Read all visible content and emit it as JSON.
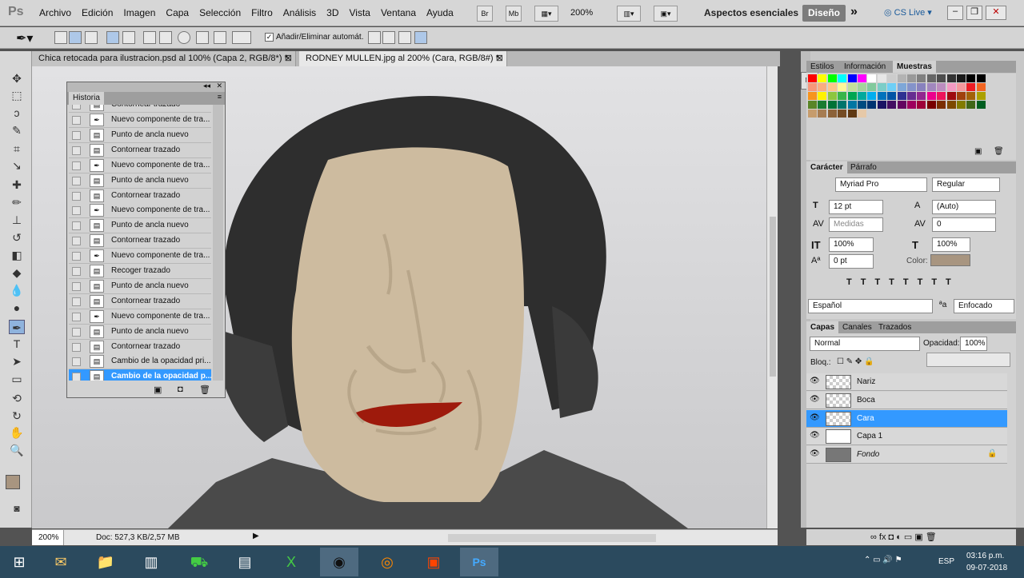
{
  "app": {
    "logo": "Ps"
  },
  "menus": [
    "Archivo",
    "Edición",
    "Imagen",
    "Capa",
    "Selección",
    "Filtro",
    "Análisis",
    "3D",
    "Vista",
    "Ventana",
    "Ayuda"
  ],
  "topbar": {
    "br": "Br",
    "mb": "Mb",
    "zoom": "200%",
    "workspace": "Aspectos esenciales",
    "design": "Diseño",
    "cslive": "CS Live"
  },
  "options": {
    "add_remove": "Añadir/Eliminar automát."
  },
  "tabs": [
    {
      "label": "Chica retocada para ilustracion.psd al 100% (Capa 2, RGB/8*) *"
    },
    {
      "label": "RODNEY MULLEN.jpg al 200% (Cara, RGB/8#) *"
    }
  ],
  "history": {
    "title": "Historia",
    "items": [
      {
        "icon": "pen-icon",
        "label": "Nuevo componente de tra..."
      },
      {
        "icon": "doc-icon",
        "label": "Punto de ancla nuevo"
      },
      {
        "icon": "doc-icon",
        "label": "Contornear trazado"
      },
      {
        "icon": "pen-icon",
        "label": "Nuevo componente de tra..."
      },
      {
        "icon": "doc-icon",
        "label": "Punto de ancla nuevo"
      },
      {
        "icon": "doc-icon",
        "label": "Contornear trazado"
      },
      {
        "icon": "pen-icon",
        "label": "Nuevo componente de tra..."
      },
      {
        "icon": "doc-icon",
        "label": "Punto de ancla nuevo"
      },
      {
        "icon": "doc-icon",
        "label": "Contornear trazado"
      },
      {
        "icon": "pen-icon",
        "label": "Nuevo componente de tra..."
      },
      {
        "icon": "doc-icon",
        "label": "Recoger trazado"
      },
      {
        "icon": "doc-icon",
        "label": "Punto de ancla nuevo"
      },
      {
        "icon": "doc-icon",
        "label": "Contornear trazado"
      },
      {
        "icon": "pen-icon",
        "label": "Nuevo componente de tra..."
      },
      {
        "icon": "doc-icon",
        "label": "Punto de ancla nuevo"
      },
      {
        "icon": "doc-icon",
        "label": "Contornear trazado"
      },
      {
        "icon": "doc-icon",
        "label": "Cambio de la opacidad pri..."
      },
      {
        "icon": "doc-icon",
        "label": "Cambio de la opacidad p...",
        "selected": true
      }
    ],
    "partial_top": "Contornear trazado"
  },
  "right": {
    "swatch_tabs": [
      "Estilos",
      "Información",
      "Muestras"
    ],
    "char_tabs": [
      "Carácter",
      "Párrafo"
    ],
    "font": "Myriad Pro",
    "style": "Regular",
    "size": "12 pt",
    "leading": "(Auto)",
    "kerning": "Medidas",
    "tracking": "0",
    "vscale": "100%",
    "hscale": "100%",
    "baseline": "0 pt",
    "color_label": "Color:",
    "language": "Español",
    "aa": "Enfocado",
    "layer_tabs": [
      "Capas",
      "Canales",
      "Trazados"
    ],
    "blend": "Normal",
    "opacity_label": "Opacidad:",
    "opacity": "100%",
    "lock_label": "Bloq.:"
  },
  "layers": [
    {
      "name": "Nariz"
    },
    {
      "name": "Boca"
    },
    {
      "name": "Cara",
      "selected": true
    },
    {
      "name": "Capa 1"
    },
    {
      "name": "Fondo",
      "italic": true
    }
  ],
  "status": {
    "zoom": "200%",
    "doc": "Doc: 527,3 KB/2,57 MB"
  },
  "taskbar": {
    "lang": "ESP",
    "time": "03:16 p.m.",
    "date": "09-07-2018"
  },
  "colors": {
    "accent": "#3399ff",
    "face": "#cdbb9f",
    "lips": "#9e1a0c"
  }
}
